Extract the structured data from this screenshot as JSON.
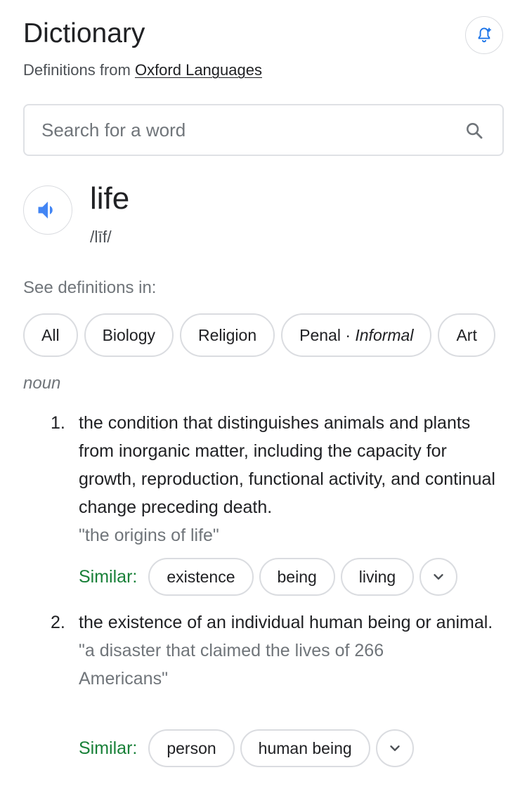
{
  "header": {
    "title": "Dictionary",
    "subtitle_prefix": "Definitions from ",
    "subtitle_link": "Oxford Languages",
    "alert_icon": "bell-plus-icon"
  },
  "search": {
    "placeholder": "Search for a word",
    "value": "",
    "icon": "search-icon"
  },
  "entry": {
    "word": "life",
    "phonetic": "/līf/",
    "audio_icon": "speaker-icon"
  },
  "filters": {
    "label": "See definitions in:",
    "chips": [
      {
        "label": "All"
      },
      {
        "label": "Biology"
      },
      {
        "label": "Religion"
      },
      {
        "label": "Penal · ",
        "italic": "Informal"
      },
      {
        "label": "Art"
      }
    ]
  },
  "part_of_speech": "noun",
  "senses": [
    {
      "number": "1.",
      "definition": "the condition that distinguishes animals and plants from inorganic matter, including the capacity for growth, reproduction, functional activity, and continual change preceding death.",
      "example": "\"the origins of life\"",
      "similar_label": "Similar:",
      "similar": [
        "existence",
        "being",
        "living"
      ]
    },
    {
      "number": "2.",
      "definition": "the existence of an individual human being or animal.",
      "example": "\"a disaster that claimed the lives of 266 Americans\"",
      "similar_label": "Similar:",
      "similar": [
        "person",
        "human being"
      ]
    }
  ],
  "colors": {
    "accent_blue": "#4285f4",
    "similar_green": "#188038",
    "border": "#dadce0"
  }
}
